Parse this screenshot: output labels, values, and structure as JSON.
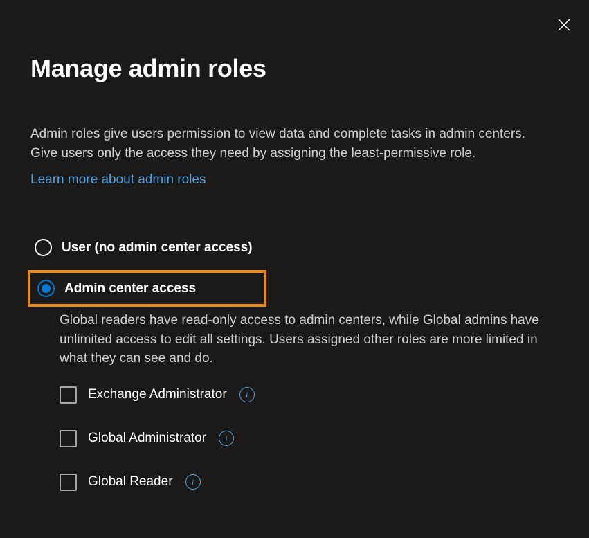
{
  "dialog": {
    "title": "Manage admin roles",
    "description": "Admin roles give users permission to view data and complete tasks in admin centers. Give users only the access they need by assigning the least-permissive role.",
    "learn_more": "Learn more about admin roles"
  },
  "access_options": {
    "no_admin": {
      "label": "User (no admin center access)",
      "selected": false
    },
    "admin_center": {
      "label": "Admin center access",
      "selected": true,
      "description": "Global readers have read-only access to admin centers, while Global admins have unlimited access to edit all settings. Users assigned other roles are more limited in what they can see and do."
    }
  },
  "roles": [
    {
      "label": "Exchange Administrator",
      "checked": false
    },
    {
      "label": "Global Administrator",
      "checked": false
    },
    {
      "label": "Global Reader",
      "checked": false
    }
  ]
}
